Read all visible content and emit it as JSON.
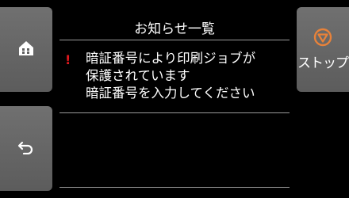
{
  "screen": {
    "title": "お知らせ一覧"
  },
  "message": {
    "text": "暗証番号により印刷ジョブが\n保護されています\n暗証番号を入力してください",
    "icon": "warning-exclamation-icon",
    "icon_color": "#e0181e"
  },
  "buttons": {
    "home": {
      "icon": "home-icon"
    },
    "back": {
      "icon": "back-arrow-icon"
    },
    "stop": {
      "icon": "stop-icon",
      "label": "ストップ",
      "icon_color": "#e8823a"
    }
  }
}
